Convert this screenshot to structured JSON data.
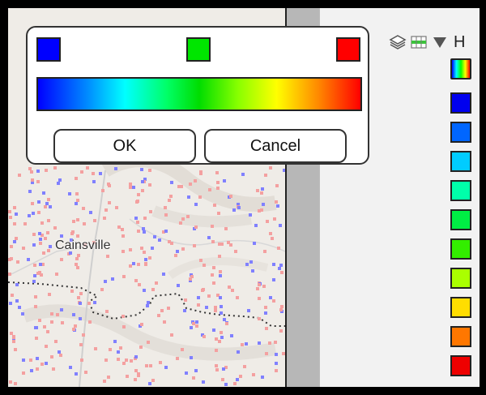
{
  "map": {
    "place_label": "Cainsville"
  },
  "color_picker": {
    "stop_colors": {
      "start": "#0000ff",
      "middle": "#00e600",
      "end": "#ff0000"
    },
    "gradient_colors": [
      "#0000ff",
      "#0088ff",
      "#00ffff",
      "#00ff66",
      "#00dd00",
      "#88ff00",
      "#ffff00",
      "#ff8800",
      "#ff0000"
    ],
    "ok_label": "OK",
    "cancel_label": "Cancel"
  },
  "toolbar": {
    "icons": [
      "layers-icon",
      "table-icon",
      "dropdown-triangle-icon"
    ],
    "truncated_text": "H"
  },
  "legend": {
    "swatches": [
      {
        "name": "spectrum",
        "color": "gradient"
      },
      {
        "name": "blue",
        "color": "#0000ee"
      },
      {
        "name": "azure",
        "color": "#0066ff"
      },
      {
        "name": "cyan",
        "color": "#00ccff"
      },
      {
        "name": "aquamarine",
        "color": "#00ffaa"
      },
      {
        "name": "green",
        "color": "#00ee44"
      },
      {
        "name": "lime",
        "color": "#33ee00"
      },
      {
        "name": "yellow-green",
        "color": "#aaff00"
      },
      {
        "name": "gold",
        "color": "#ffdd00"
      },
      {
        "name": "orange",
        "color": "#ff7700"
      },
      {
        "name": "red",
        "color": "#ee0000"
      }
    ]
  }
}
